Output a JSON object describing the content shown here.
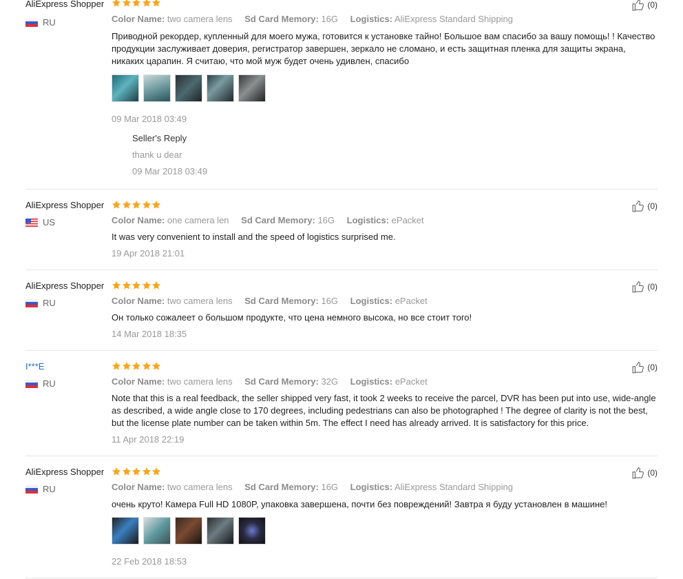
{
  "colors": {
    "star": "#f5a623",
    "link_user": "#1a6fc9",
    "border": "#e6e6e6"
  },
  "labels": {
    "color_name": "Color Name:",
    "sd_card": "Sd Card Memory:",
    "logistics": "Logistics:"
  },
  "reviews": [
    {
      "user": "AliExpress Shopper",
      "country": "RU",
      "stars": 5,
      "color_name": "two camera lens",
      "sd_card": "16G",
      "logistics": "AliExpress Standard Shipping",
      "text": "Приводной рекордер, купленный для моего мужа, готовится к установке тайно! Большое вам спасибо за вашу помощь! ! Качество продукции заслуживает доверия, регистратор завершен, зеркало не сломано, и есть защитная пленка для защиты экрана, никаких царапин. Я считаю, что мой муж будет очень удивлен, спасибо",
      "photos": 5,
      "date": "09 Mar 2018 03:49",
      "likes": "(0)",
      "reply": {
        "title": "Seller's Reply",
        "text": "thank u dear",
        "date": "09 Mar 2018 03:49"
      }
    },
    {
      "user": "AliExpress Shopper",
      "country": "US",
      "stars": 5,
      "color_name": "one camera len",
      "sd_card": "16G",
      "logistics": "ePacket",
      "text": "It was very convenient to install and the speed of logistics surprised me.",
      "date": "19 Apr 2018 21:01",
      "likes": "(0)"
    },
    {
      "user": "AliExpress Shopper",
      "country": "RU",
      "stars": 5,
      "color_name": "two camera lens",
      "sd_card": "16G",
      "logistics": "ePacket",
      "text": "Он только сожалеет о большом продукте, что цена немного высока, но все стоит того!",
      "date": "14 Mar 2018 18:35",
      "likes": "(0)"
    },
    {
      "user": "I***E",
      "country": "RU",
      "stars": 5,
      "color_name": "two camera lens",
      "sd_card": "32G",
      "logistics": "ePacket",
      "text": "Note that this is a real feedback, the seller shipped very fast, it took 2 weeks to receive the parcel, DVR has been put into use, wide-angle as described, a wide angle close to 170 degrees, including pedestrians can also be photographed ! The degree of clarity is not the best, but the license plate number can be taken within 5m. The effect I need has already arrived. It is satisfactory for this price.",
      "date": "11 Apr 2018 22:19",
      "likes": "(0)"
    },
    {
      "user": "AliExpress Shopper",
      "country": "RU",
      "stars": 5,
      "color_name": "two camera lens",
      "sd_card": "16G",
      "logistics": "AliExpress Standard Shipping",
      "text": "очень круто! Камера Full HD 1080P, упаковка завершена, почти без повреждений! Завтра я буду установлен в машине!",
      "photos": 5,
      "date": "22 Feb 2018 18:53",
      "likes": "(0)"
    }
  ]
}
